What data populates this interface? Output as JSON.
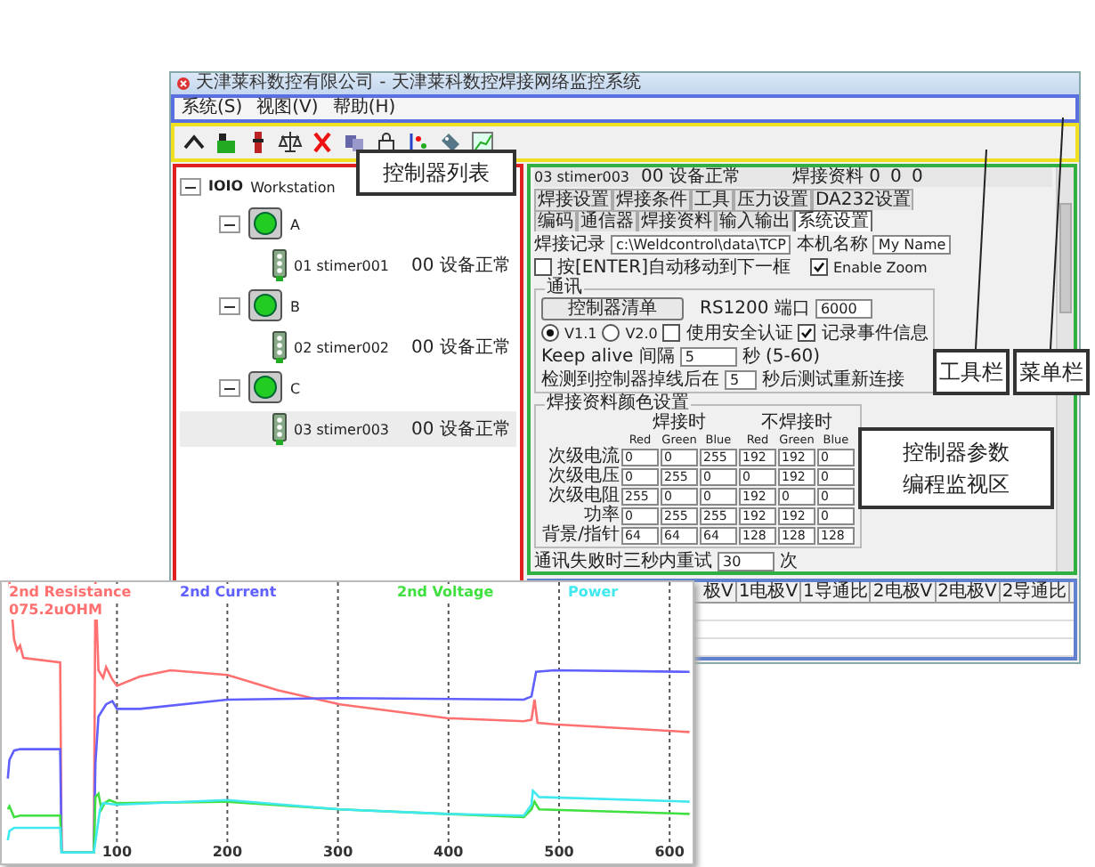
{
  "window": {
    "title": "天津莱科数控有限公司 - 天津莱科数控焊接网络监控系统"
  },
  "menu": [
    "系统(S)",
    "视图(V)",
    "帮助(H)"
  ],
  "tree": {
    "root_code": "IOIO",
    "root_name": "Workstation",
    "expanded": true,
    "children": [
      {
        "name": "A",
        "expanded": true,
        "children": [
          {
            "name": "01 stimer001",
            "status": "00 设备正常",
            "selected": false
          }
        ]
      },
      {
        "name": "B",
        "expanded": true,
        "children": [
          {
            "name": "02 stimer002",
            "status": "00 设备正常",
            "selected": false
          }
        ]
      },
      {
        "name": "C",
        "expanded": true,
        "children": [
          {
            "name": "03 stimer003",
            "status": "00 设备正常",
            "selected": true
          }
        ]
      }
    ]
  },
  "monitor": {
    "header": [
      "03 stimer003",
      "00 设备正常",
      "焊接资料 0",
      "0",
      "0"
    ],
    "tabs": [
      {
        "label": "焊接设置",
        "selected": false
      },
      {
        "label": "焊接条件",
        "selected": false
      },
      {
        "label": "工具",
        "selected": false
      },
      {
        "label": "压力设置",
        "selected": false
      },
      {
        "label": "DA232设置",
        "selected": false
      },
      {
        "label": "编码",
        "selected": false
      },
      {
        "label": "通信器",
        "selected": false
      },
      {
        "label": "焊接资料",
        "selected": false
      },
      {
        "label": "输入输出",
        "selected": false
      },
      {
        "label": "系统设置",
        "selected": true
      }
    ],
    "record_path": {
      "label": "焊接记录",
      "value": "c:\\Weldcontrol\\data\\TCP"
    },
    "machine_name": {
      "label": "本机名称",
      "value": "My Name"
    },
    "checks": [
      {
        "label": "按[ENTER]自动移动到下一框",
        "checked": false
      },
      {
        "label": "Enable Zoom",
        "checked": true
      }
    ],
    "comm": {
      "title": "通讯",
      "button": "控制器清单",
      "port_label": "RS1200 端口",
      "port": "6000",
      "options": [
        {
          "label": "使用安全认证",
          "checked": false
        },
        {
          "label": "记录事件信息",
          "checked": true
        }
      ],
      "versions": [
        {
          "label": "V1.1",
          "selected": true
        },
        {
          "label": "V2.0",
          "selected": false
        }
      ],
      "keepalive": {
        "label": "Keep alive 间隔",
        "value": "5",
        "unit": "秒 (5-60)"
      },
      "reconnect": {
        "label": "检测到控制器掉线后在",
        "value": "5",
        "unit": "秒后测试重新连接"
      }
    },
    "colors": {
      "title": "焊接资料颜色设置",
      "groups": [
        "焊接时",
        "不焊接时"
      ],
      "channels": [
        "Red",
        "Green",
        "Blue",
        "Red",
        "Green",
        "Blue"
      ],
      "rows": [
        {
          "label": "次级电流",
          "values": [
            "0",
            "0",
            "255",
            "192",
            "192",
            "0"
          ]
        },
        {
          "label": "次级电压",
          "values": [
            "0",
            "255",
            "0",
            "0",
            "192",
            "0"
          ]
        },
        {
          "label": "次级电阻",
          "values": [
            "255",
            "0",
            "0",
            "192",
            "0",
            "0"
          ]
        },
        {
          "label": "功率",
          "values": [
            "0",
            "255",
            "255",
            "192",
            "192",
            "0"
          ]
        },
        {
          "label": "背景/指针",
          "values": [
            "64",
            "64",
            "64",
            "128",
            "128",
            "128"
          ]
        }
      ]
    },
    "retry": {
      "label": "通讯失败时三秒内重试",
      "value": "30",
      "unit": "次"
    }
  },
  "data_table": {
    "columns": [
      "极V",
      "1电极V",
      "1导通比",
      "2电极V",
      "2电极V",
      "2导通比"
    ]
  },
  "chart": {
    "series": [
      {
        "name": "2nd Resistance",
        "color": "#ff7070"
      },
      {
        "name": "2nd Current",
        "color": "#6060ff"
      },
      {
        "name": "2nd Voltage",
        "color": "#40e040"
      },
      {
        "name": "Power",
        "color": "#40e8f0"
      }
    ],
    "reading": "075.2uOHM",
    "xticks": [
      "100",
      "200",
      "300",
      "400",
      "500",
      "600"
    ]
  },
  "callouts": [
    {
      "lines": [
        "控制器列表"
      ]
    },
    {
      "lines": [
        "工具栏"
      ]
    },
    {
      "lines": [
        "菜单栏"
      ]
    },
    {
      "lines": [
        "控制器参数",
        "编程监视区"
      ]
    }
  ]
}
